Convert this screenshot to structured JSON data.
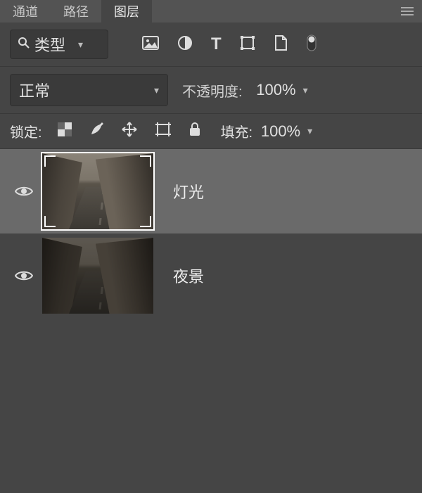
{
  "tabs": {
    "channels": "通道",
    "paths": "路径",
    "layers": "图层"
  },
  "active_tab": "图层",
  "filter": {
    "label": "类型",
    "icon": "search-icon"
  },
  "blend": {
    "mode": "正常",
    "opacity_label": "不透明度:",
    "opacity_value": "100%"
  },
  "lock": {
    "label": "锁定:",
    "fill_label": "填充:",
    "fill_value": "100%"
  },
  "layers": [
    {
      "name": "灯光",
      "visible": true,
      "selected": true
    },
    {
      "name": "夜景",
      "visible": true,
      "selected": false
    }
  ]
}
